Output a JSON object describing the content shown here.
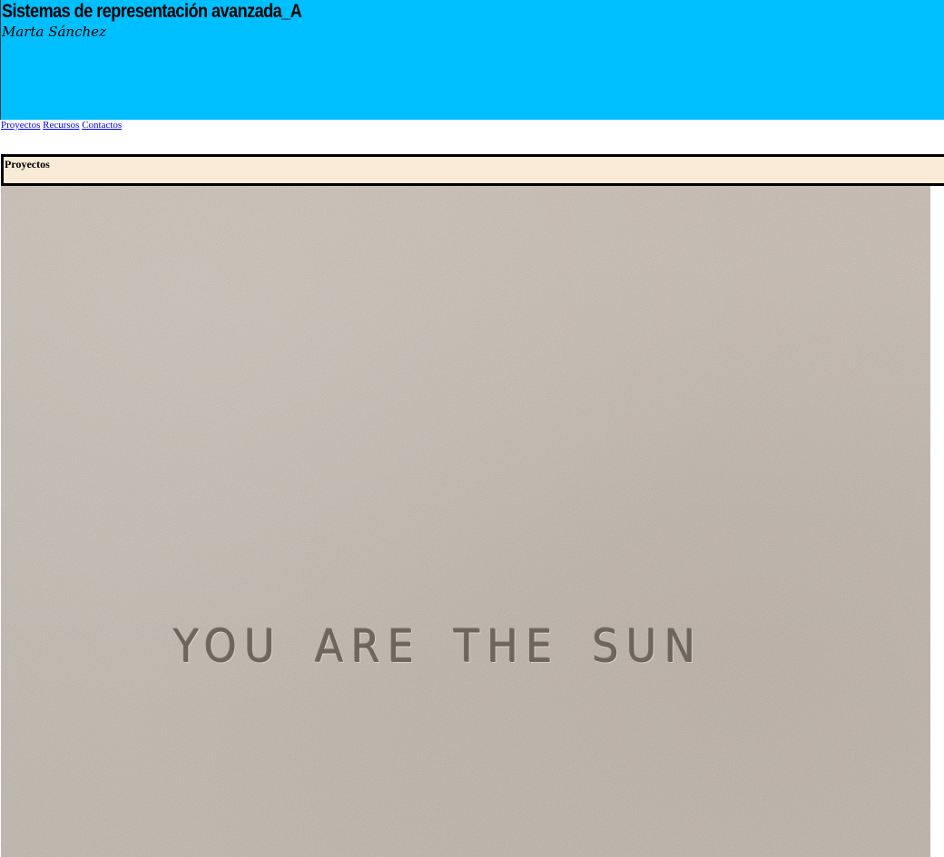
{
  "header": {
    "title": "Sistemas de representación avanzada_A",
    "author": "Marta Sánchez",
    "background_color": "#00bfff"
  },
  "nav": {
    "items": [
      {
        "label": "Proyectos"
      },
      {
        "label": "Recursos"
      },
      {
        "label": "Contactos"
      }
    ]
  },
  "section": {
    "title": "Proyectos",
    "background_color": "#faebd7"
  },
  "hero": {
    "embossed_text": "YOU ARE THE SUN"
  }
}
